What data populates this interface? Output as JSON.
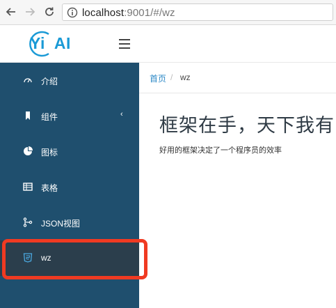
{
  "browser": {
    "url_host": "localhost",
    "url_rest": ":9001/#/wz",
    "icons": [
      "back-arrow-icon",
      "forward-arrow-icon",
      "reload-icon",
      "info-icon"
    ]
  },
  "header": {
    "logo_yi": "Yi",
    "logo_ai": "AI",
    "menu_icon": "hamburger-icon"
  },
  "sidebar": {
    "items": [
      {
        "label": "介绍",
        "icon": "gauge-icon"
      },
      {
        "label": "组件",
        "icon": "bookmark-icon",
        "caret": "‹"
      },
      {
        "label": "图标",
        "icon": "pie-chart-icon"
      },
      {
        "label": "表格",
        "icon": "table-icon"
      },
      {
        "label": "JSON视图",
        "icon": "code-fork-icon"
      },
      {
        "label": "wz",
        "icon": "html5-icon",
        "active": true
      }
    ]
  },
  "breadcrumb": {
    "home": "首页",
    "separator": "/",
    "current": "wz"
  },
  "main": {
    "title": "框架在手，天下我有",
    "subtitle": "好用的框架决定了一个程序员的效率"
  },
  "colors": {
    "sidebar_bg": "#1f4f6e",
    "active_bg": "#2b3e4c",
    "highlight": "#f03a22",
    "link": "#2e8ac7",
    "logo": "#1a9ad6"
  }
}
